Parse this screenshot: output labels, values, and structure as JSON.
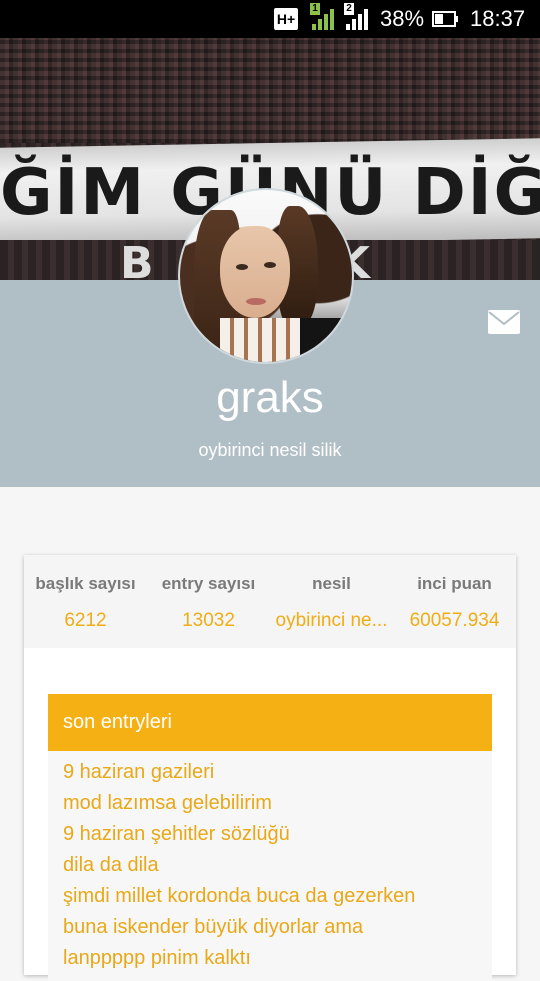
{
  "status_bar": {
    "network": "H+",
    "sim1": "1",
    "sim2": "2",
    "battery_percent": "38%",
    "time": "18:37"
  },
  "cover": {
    "banner_text": "ĞİM GÜNÜ DİĞİL",
    "banner_bottom_text": "B Ş K"
  },
  "profile": {
    "username": "graks",
    "subtitle": "oybirinci nesil silik"
  },
  "stats": [
    {
      "label": "başlık sayısı",
      "value": "6212"
    },
    {
      "label": "entry sayısı",
      "value": "13032"
    },
    {
      "label": "nesil",
      "value": "oybirinci ne..."
    },
    {
      "label": "inci puan",
      "value": "60057.934"
    }
  ],
  "entries": {
    "title": "son entryleri",
    "items": [
      "9 haziran gazileri",
      "mod lazımsa gelebilirim",
      "9 haziran şehitler sözlüğü",
      "dila da dila",
      "şimdi millet kordonda buca da gezerken",
      "buna iskender büyük diyorlar ama",
      "lanppppp pinim kalktı"
    ]
  },
  "icons": {
    "mail": "mail-icon",
    "signal": "signal-icon",
    "battery": "battery-icon"
  },
  "colors": {
    "accent": "#f5b014",
    "band": "#b0bfc6",
    "value_text": "#f0ad14"
  }
}
